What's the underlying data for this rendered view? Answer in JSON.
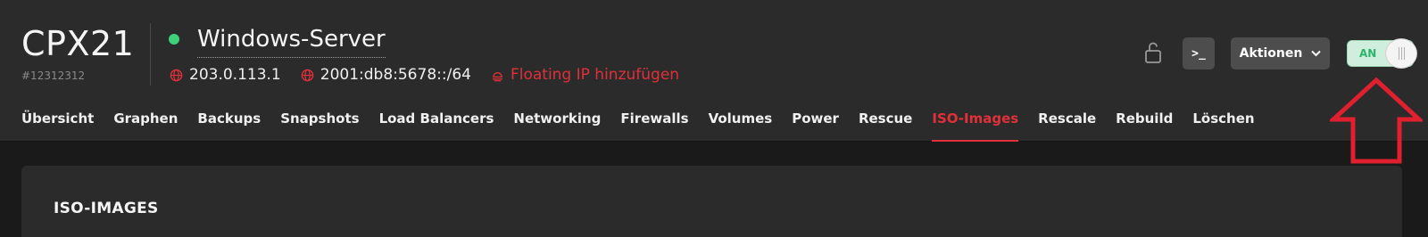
{
  "server": {
    "type": "CPX21",
    "id": "#12312312",
    "name": "Windows-Server",
    "ipv4": "203.0.113.1",
    "ipv6": "2001:db8:5678::/64",
    "floating_ip_label": "Floating IP hinzufügen",
    "status_color": "#3ed17a"
  },
  "toolbar": {
    "console_label": ">_",
    "actions_label": "Aktionen",
    "power_toggle_label": "AN"
  },
  "tabs": [
    {
      "label": "Übersicht"
    },
    {
      "label": "Graphen"
    },
    {
      "label": "Backups"
    },
    {
      "label": "Snapshots"
    },
    {
      "label": "Load Balancers"
    },
    {
      "label": "Networking"
    },
    {
      "label": "Firewalls"
    },
    {
      "label": "Volumes"
    },
    {
      "label": "Power"
    },
    {
      "label": "Rescue"
    },
    {
      "label": "ISO-Images",
      "active": true
    },
    {
      "label": "Rescale"
    },
    {
      "label": "Rebuild"
    },
    {
      "label": "Löschen"
    }
  ],
  "main": {
    "section_title": "ISO-IMAGES"
  },
  "colors": {
    "accent": "#e0303a",
    "annotation_arrow": "#e0202e"
  }
}
